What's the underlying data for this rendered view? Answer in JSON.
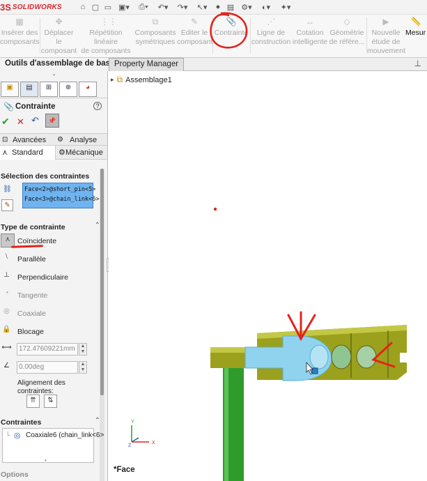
{
  "app": {
    "logo_mark": "3S",
    "logo_text": "SOLIDWORKS"
  },
  "quick_access": [
    "home-icon",
    "new-icon",
    "open-icon",
    "save-icon",
    "print-icon",
    "undo-icon",
    "redo-icon",
    "select-icon",
    "rebuild-icon",
    "file-props-icon",
    "options-icon",
    "view-icon",
    "display-icon"
  ],
  "ribbon": {
    "items": [
      {
        "label": "Insérer des composants",
        "line1": "Insérer des",
        "line2": "composants"
      },
      {
        "label": "Déplacer le composant",
        "line1": "Déplacer le",
        "line2": "composant"
      },
      {
        "label": "Répétition linéaire de composants",
        "line1": "Répétition linéaire",
        "line2": "de composants"
      },
      {
        "label": "Composants symétriques",
        "line1": "Composants",
        "line2": "symétriques"
      },
      {
        "label": "Editer le composant",
        "line1": "Editer le",
        "line2": "composant"
      },
      {
        "label": "Contrainte",
        "line1": "Contrainte",
        "line2": ""
      },
      {
        "label": "Ligne de construction",
        "line1": "Ligne de",
        "line2": "construction"
      },
      {
        "label": "Cotation intelligente",
        "line1": "Cotation",
        "line2": "intelligente"
      },
      {
        "label": "Géométrie de référence",
        "line1": "Géométrie",
        "line2": "de référe..."
      },
      {
        "label": "Nouvelle étude de mouvement",
        "line1": "Nouvelle",
        "line2": "étude de",
        "line3": "mouvement"
      },
      {
        "label": "Mesurer",
        "line1": "Mesur",
        "line2": ""
      }
    ]
  },
  "command_tabs": {
    "left": "Outils d'assemblage de base",
    "right": "Property Manager"
  },
  "panel": {
    "tabs": [
      "feature-manager-icon",
      "property-manager-icon",
      "config-manager-icon",
      "dimxpert-icon",
      "display-manager-icon"
    ],
    "title": "Contrainte",
    "help_label": "?",
    "subtabs": {
      "avancees": "Avancées",
      "analyse": "Analyse",
      "standard": "Standard",
      "mecanique": "Mécanique"
    },
    "selection": {
      "heading": "Sélection des contraintes",
      "items": [
        "Face<2>@short_pin<5>",
        "Face<3>@chain_link<6>"
      ]
    },
    "type": {
      "heading": "Type de contrainte",
      "options": [
        "Coïncidente",
        "Parallèle",
        "Perpendiculaire",
        "Tangente",
        "Coaxiale",
        "Blocage"
      ],
      "distance": "172.47609221mm",
      "angle": "0.00deg",
      "alignment": "Alignement des contraintes:"
    },
    "mates": {
      "heading": "Contraintes",
      "items": [
        "Coaxiale6 (chain_link<6>"
      ]
    },
    "footer": "Options"
  },
  "viewport": {
    "tree_root": "Assemblage1",
    "status": "*Face",
    "triad": {
      "x": "X",
      "y": "Y",
      "z": "Z"
    },
    "colors": {
      "yellow": "#9ba11c",
      "blue": "#8fd3ef",
      "green": "#2e9b2c",
      "annotation": "#e3231b"
    }
  }
}
